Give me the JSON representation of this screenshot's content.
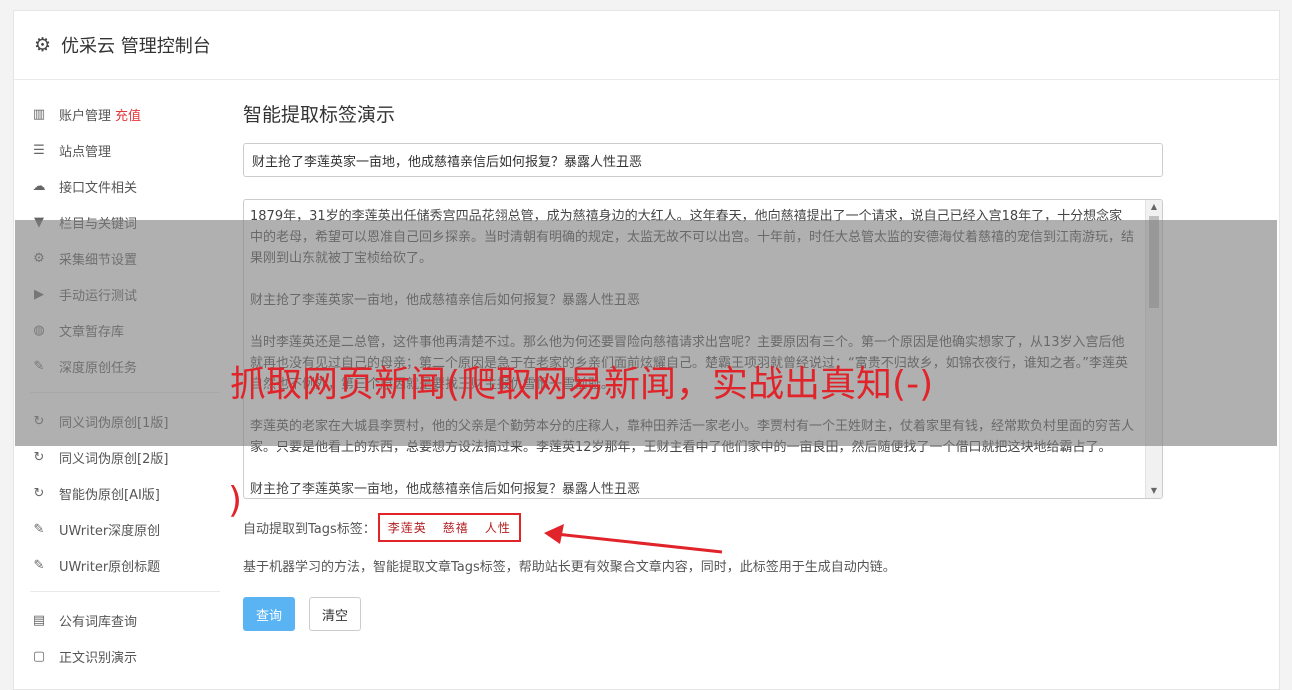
{
  "header": {
    "gear_icon": "gear-icon",
    "title": "优采云 管理控制台"
  },
  "sidebar": {
    "group1": [
      {
        "icon": "bar-chart-icon",
        "glyph": "▥",
        "label": "账户管理",
        "extra": "充值"
      },
      {
        "icon": "server-icon",
        "glyph": "☰",
        "label": "站点管理"
      },
      {
        "icon": "cloud-upload-icon",
        "glyph": "☁",
        "label": "接口文件相关"
      },
      {
        "icon": "filter-icon",
        "glyph": "▼",
        "label": "栏目与关键词"
      },
      {
        "icon": "cogs-icon",
        "glyph": "⚙",
        "label": "采集细节设置"
      },
      {
        "icon": "play-icon",
        "glyph": "▶",
        "label": "手动运行测试"
      },
      {
        "icon": "database-icon",
        "glyph": "◍",
        "label": "文章暂存库"
      },
      {
        "icon": "edit-icon",
        "glyph": "✎",
        "label": "深度原创任务"
      }
    ],
    "group2": [
      {
        "icon": "refresh-icon",
        "glyph": "↻",
        "label": "同义词伪原创[1版]"
      },
      {
        "icon": "refresh-icon",
        "glyph": "↻",
        "label": "同义词伪原创[2版]"
      },
      {
        "icon": "refresh-icon",
        "glyph": "↻",
        "label": "智能伪原创[AI版]"
      },
      {
        "icon": "edit-icon",
        "glyph": "✎",
        "label": "UWriter深度原创"
      },
      {
        "icon": "edit-icon",
        "glyph": "✎",
        "label": "UWriter原创标题"
      }
    ],
    "group3": [
      {
        "icon": "book-icon",
        "glyph": "▤",
        "label": "公有词库查询"
      },
      {
        "icon": "square-icon",
        "glyph": "▢",
        "label": "正文识别演示"
      }
    ]
  },
  "main": {
    "heading": "智能提取标签演示",
    "title_value": "财主抢了李莲英家一亩地，他成慈禧亲信后如何报复？暴露人性丑恶",
    "article_text": "1879年，31岁的李莲英出任储秀宫四品花翎总管，成为慈禧身边的大红人。这年春天，他向慈禧提出了一个请求，说自己已经入宫18年了，十分想念家中的老母，希望可以恩准自己回乡探亲。当时清朝有明确的规定，太监无故不可以出宫。十年前，时任大总管太监的安德海仗着慈禧的宠信到江南游玩，结果刚到山东就被丁宝桢给砍了。\n\n财主抢了李莲英家一亩地，他成慈禧亲信后如何报复？暴露人性丑恶\n\n当时李莲英还是二总管，这件事他再清楚不过。那么他为何还要冒险向慈禧请求出宫呢？主要原因有三个。第一个原因是他确实想家了，从13岁入宫后他就再也没有见过自己的母亲；第二个原因是急于在老家的乡亲们面前炫耀自己。楚霸王项羽就曾经说过：“富贵不归故乡，如锦衣夜行，谁知之者。”李莲英自然也不例外，第三个原因就是要找王财主报仇雪恨一雪前耻。\n\n李莲英的老家在大城县李贾村，他的父亲是个勤劳本分的庄稼人，靠种田养活一家老小。李贾村有一个王姓财主，仗着家里有钱，经常欺负村里面的穷苦人家。只要是他看上的东西，总要想方设法搞过来。李莲英12岁那年，王财主看中了他们家中的一亩良田，然后随便找了一个借口就把这块地给霸占了。\n\n财主抢了李莲英家一亩地，他成慈禧亲信后如何报复？暴露人性丑恶",
    "tags_label": "自动提取到Tags标签：",
    "tags": [
      "李莲英",
      "慈禧",
      "人性"
    ],
    "description": "基于机器学习的方法，智能提取文章Tags标签，帮助站长更有效聚合文章内容，同时，此标签用于生成自动内链。",
    "query_button": "查询",
    "clear_button": "清空"
  },
  "overlay": {
    "title": "抓取网页新闻(爬取网易新闻，实战出真知(-)",
    "title_tail": ")",
    "accent_color": "#e0242a"
  }
}
